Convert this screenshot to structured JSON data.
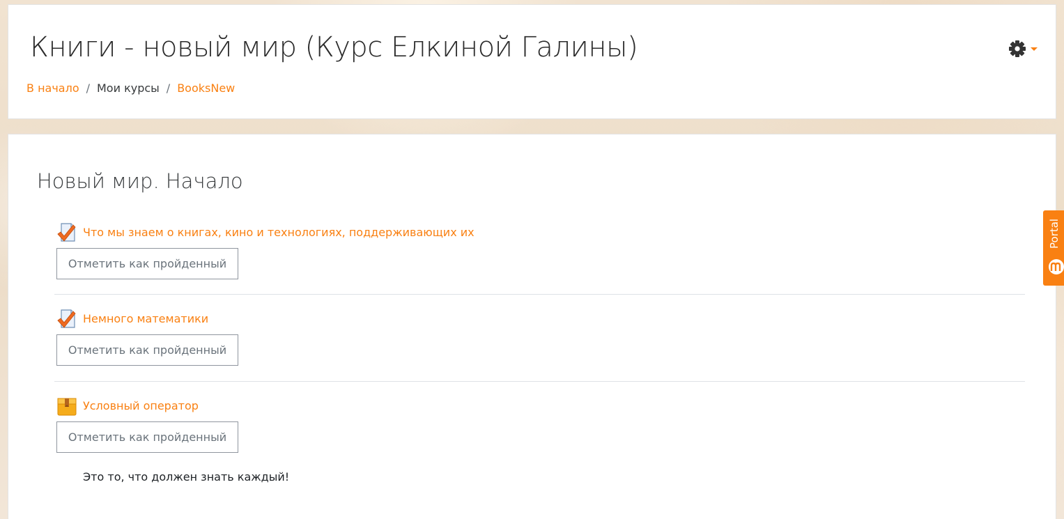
{
  "header": {
    "title": "Книги - новый мир (Курс Елкиной Галины)",
    "settings_icon": "gear-icon",
    "breadcrumb": [
      {
        "label": "В начало",
        "link": true
      },
      {
        "label": "Мои курсы",
        "link": false
      },
      {
        "label": "BooksNew",
        "link": true
      }
    ],
    "breadcrumb_separator": "/"
  },
  "section": {
    "title": "Новый мир. Начало",
    "activities": [
      {
        "icon": "assignment-checkmark-icon",
        "title": "Что мы знаем о книгах, кино и технологиях, поддерживающих их",
        "button": "Отметить как пройденный"
      },
      {
        "icon": "assignment-checkmark-icon",
        "title": "Немного математики",
        "button": "Отметить как пройденный"
      },
      {
        "icon": "package-box-icon",
        "title": "Условный оператор",
        "button": "Отметить как пройденный",
        "description": "Это то, что должен знать каждый!"
      }
    ]
  },
  "portal_tab": {
    "label": "Portal",
    "icon": "moodle-logo-icon"
  },
  "colors": {
    "link": "#f98012",
    "text": "#373a3c",
    "button_text": "#6a737b",
    "button_border": "#8f959e",
    "portal_tab": "#f98012"
  }
}
